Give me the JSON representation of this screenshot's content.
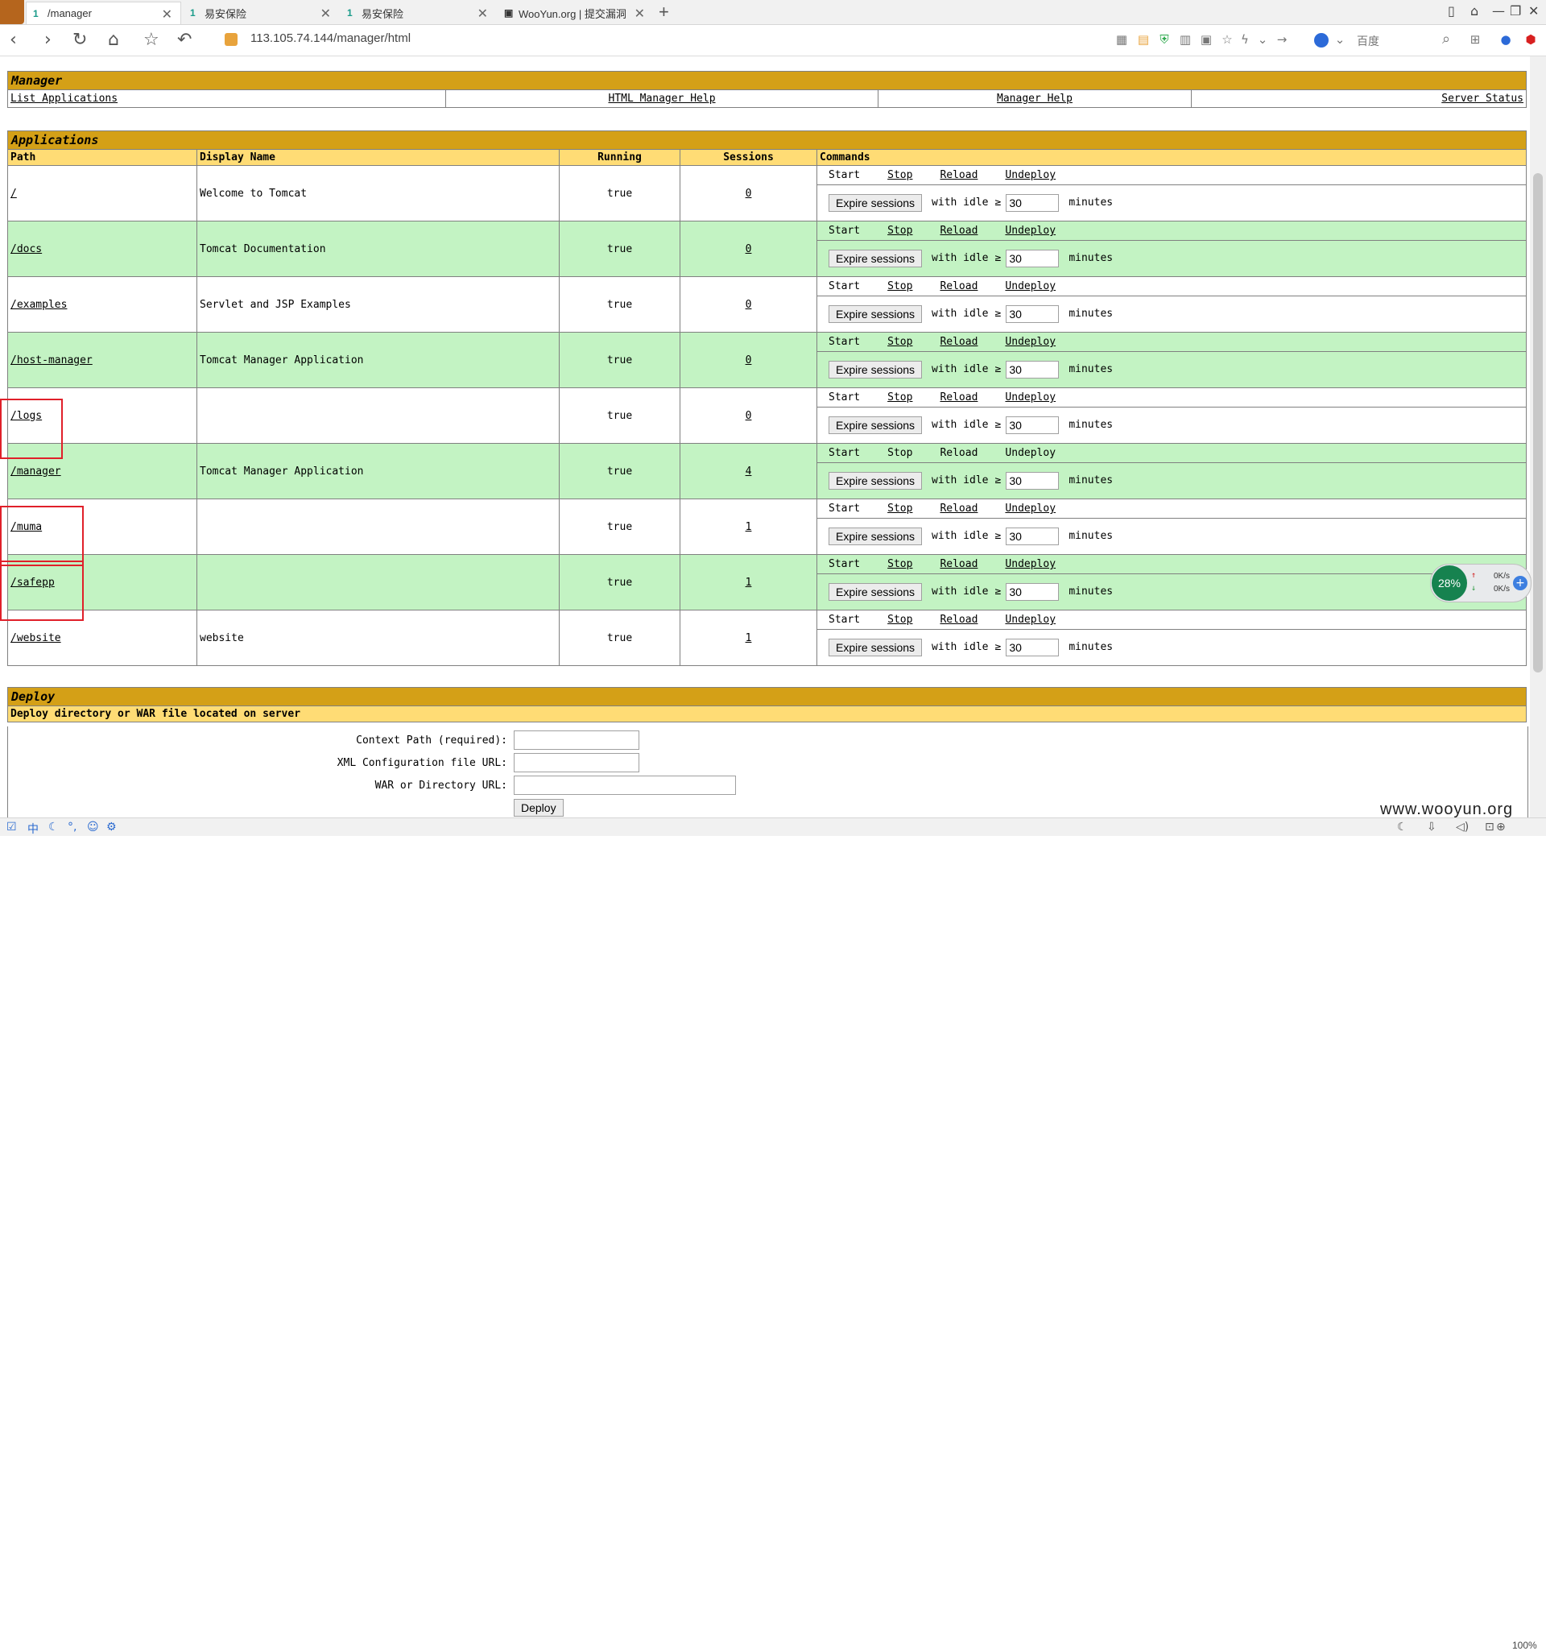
{
  "browser": {
    "tabs": [
      {
        "label": "/manager",
        "active": true
      },
      {
        "label": "易安保险",
        "active": false
      },
      {
        "label": "易安保险",
        "active": false
      },
      {
        "label": "WooYun.org | 提交漏洞",
        "active": false
      }
    ],
    "url": "113.105.74.144/manager/html",
    "search_engine_label": "百度"
  },
  "manager": {
    "title": "Manager",
    "links": [
      "List Applications",
      "HTML Manager Help",
      "Manager Help",
      "Server Status"
    ]
  },
  "applications": {
    "title": "Applications",
    "headers": {
      "path": "Path",
      "display_name": "Display Name",
      "running": "Running",
      "sessions": "Sessions",
      "commands": "Commands"
    },
    "commands": {
      "start": "Start",
      "stop": "Stop",
      "reload": "Reload",
      "undeploy": "Undeploy",
      "expire": "Expire sessions",
      "with_idle": "with idle",
      "gt": "≥",
      "minutes": "minutes"
    },
    "rows": [
      {
        "path": "/",
        "display_name": "Welcome to Tomcat",
        "running": "true",
        "sessions": "0",
        "idle": "30"
      },
      {
        "path": "/docs",
        "display_name": "Tomcat Documentation",
        "running": "true",
        "sessions": "0",
        "idle": "30"
      },
      {
        "path": "/examples",
        "display_name": "Servlet and JSP Examples",
        "running": "true",
        "sessions": "0",
        "idle": "30"
      },
      {
        "path": "/host-manager",
        "display_name": "Tomcat Manager Application",
        "running": "true",
        "sessions": "0",
        "idle": "30"
      },
      {
        "path": "/logs",
        "display_name": "",
        "running": "true",
        "sessions": "0",
        "idle": "30"
      },
      {
        "path": "/manager",
        "display_name": "Tomcat Manager Application",
        "running": "true",
        "sessions": "4",
        "idle": "30"
      },
      {
        "path": "/muma",
        "display_name": "",
        "running": "true",
        "sessions": "1",
        "idle": "30"
      },
      {
        "path": "/safepp",
        "display_name": "",
        "running": "true",
        "sessions": "1",
        "idle": "30"
      },
      {
        "path": "/website",
        "display_name": "website",
        "running": "true",
        "sessions": "1",
        "idle": "30"
      }
    ]
  },
  "deploy": {
    "title": "Deploy",
    "subtitle": "Deploy directory or WAR file located on server",
    "context_path_label": "Context Path (required):",
    "xml_config_label": "XML Configuration file URL:",
    "war_dir_label": "WAR or Directory URL:",
    "deploy_button": "Deploy"
  },
  "overlay": {
    "speed_percent": "28%",
    "up_speed": "0K/s",
    "down_speed": "0K/s",
    "watermark": "www.wooyun.org",
    "zoom": "100%"
  },
  "colors": {
    "title_bg": "#d4a017",
    "header_bg": "#ffdc75",
    "row_alt_bg": "#c3f3c3",
    "highlight_box": "#e0202a"
  }
}
